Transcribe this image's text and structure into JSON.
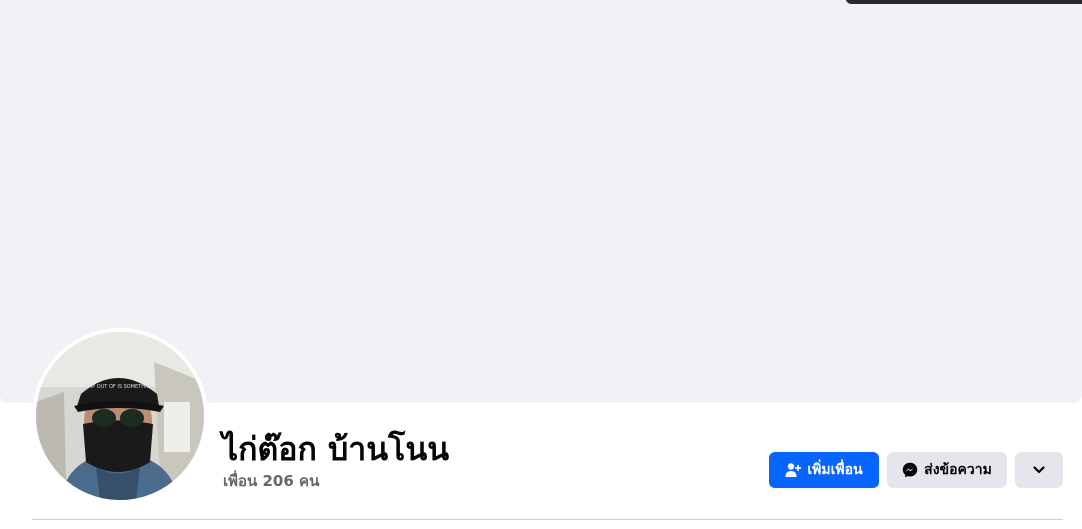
{
  "profile": {
    "name": "ไก่ต๊อก บ้านโนน",
    "friends_text": "เพื่อน 206 คน"
  },
  "avatar": {
    "cap_text": "CRAP OUT OF IS SOMETHING"
  },
  "actions": {
    "add_friend_label": "เพิ่มเพื่อน",
    "message_label": "ส่งข้อความ",
    "add_friend_icon": "add-friend-icon",
    "message_icon": "messenger-icon",
    "more_icon": "chevron-down-icon"
  },
  "colors": {
    "primary": "#0866ff",
    "secondary_button": "#e4e6eb",
    "cover": "#f0f2f5",
    "name_text": "#050505",
    "muted_text": "#65676b"
  }
}
